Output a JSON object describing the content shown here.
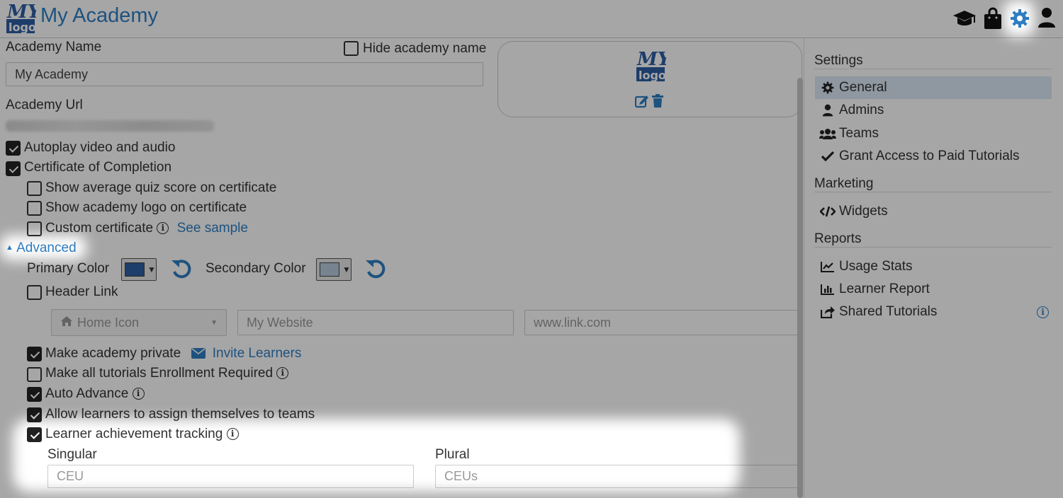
{
  "header": {
    "title": "My Academy",
    "logo_text": "MY logo",
    "icons": [
      "graduation-cap-icon",
      "shopping-bag-icon",
      "gear-icon",
      "user-icon"
    ]
  },
  "form": {
    "academy_name_label": "Academy Name",
    "hide_name_label": "Hide academy name",
    "academy_name_value": "My Academy",
    "academy_url_label": "Academy Url",
    "autoplay_label": "Autoplay video and audio",
    "certificate_label": "Certificate of Completion",
    "show_quiz_label": "Show average quiz score on certificate",
    "show_logo_label": "Show academy logo on certificate",
    "custom_cert_label": "Custom certificate",
    "see_sample_label": "See sample",
    "advanced_label": "Advanced",
    "primary_color_label": "Primary Color",
    "secondary_color_label": "Secondary Color",
    "primary_color": "#2d5ea3",
    "secondary_color": "#b9c9de",
    "header_link_label": "Header Link",
    "home_icon_select": "Home Icon",
    "website_placeholder": "My Website",
    "link_placeholder": "www.link.com",
    "private_label": "Make academy private",
    "invite_label": "Invite Learners",
    "enrollment_label": "Make all tutorials Enrollment Required",
    "auto_advance_label": "Auto Advance",
    "assign_teams_label": "Allow learners to assign themselves to teams",
    "achievement_label": "Learner achievement tracking",
    "singular_label": "Singular",
    "plural_label": "Plural",
    "singular_value": "CEU",
    "plural_value": "CEUs"
  },
  "sidebar": {
    "settings_heading": "Settings",
    "settings_items": [
      {
        "label": "General",
        "icon": "gear-icon"
      },
      {
        "label": "Admins",
        "icon": "user-icon"
      },
      {
        "label": "Teams",
        "icon": "users-icon"
      },
      {
        "label": "Grant Access to Paid Tutorials",
        "icon": "check-icon"
      }
    ],
    "marketing_heading": "Marketing",
    "marketing_items": [
      {
        "label": "Widgets",
        "icon": "code-icon"
      }
    ],
    "reports_heading": "Reports",
    "reports_items": [
      {
        "label": "Usage Stats",
        "icon": "line-chart-icon"
      },
      {
        "label": "Learner Report",
        "icon": "bar-chart-icon"
      },
      {
        "label": "Shared Tutorials",
        "icon": "share-icon"
      }
    ]
  },
  "colors": {
    "accent": "#2f7fc4",
    "active_item_bg": "#dce9f6",
    "dim_overlay": "rgba(0,0,0,0.35)"
  }
}
